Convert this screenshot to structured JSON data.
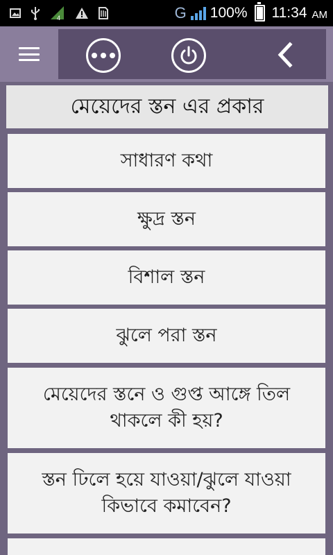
{
  "status_bar": {
    "network": "G",
    "battery": "100%",
    "time": "11:34",
    "ampm": "AM",
    "left_icons": [
      "image-icon",
      "usb-icon",
      "signal-4g-icon",
      "warning-icon",
      "sim-icon"
    ]
  },
  "toolbar": {
    "buttons": [
      "menu-icon",
      "more-icon",
      "power-icon",
      "back-icon"
    ]
  },
  "list": {
    "title": "মেয়েদের স্তন এর প্রকার",
    "items": [
      {
        "label": "সাধারণ কথা"
      },
      {
        "label": "ক্ষুদ্র স্তন"
      },
      {
        "label": "বিশাল স্তন"
      },
      {
        "label": "ঝুলে পরা স্তন"
      },
      {
        "label": "মেয়েদের স্তনে ও গুপ্ত আঙ্গে তিল থাকলে কী হয়?"
      },
      {
        "label": "স্তন ঢিলে হয়ে যাওয়া/ঝুলে যাওয়া কিভাবে কমাবেন?"
      }
    ]
  },
  "colors": {
    "toolbar": "#8a7e9c",
    "toolbar_panel": "#5a4e6c",
    "background": "#6f6580",
    "item_bg": "#f2f2f2"
  }
}
